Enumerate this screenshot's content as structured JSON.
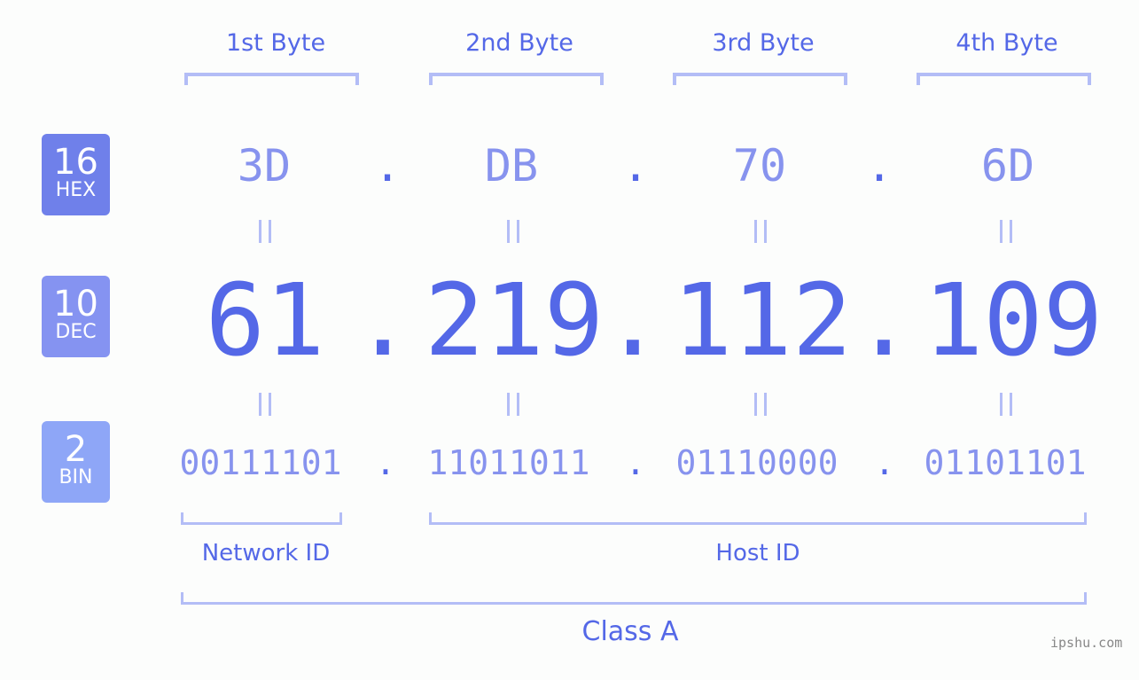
{
  "byte_headers": [
    "1st Byte",
    "2nd Byte",
    "3rd Byte",
    "4th Byte"
  ],
  "badges": {
    "hex": {
      "base": "16",
      "label": "HEX",
      "color": "#6f80ea"
    },
    "dec": {
      "base": "10",
      "label": "DEC",
      "color": "#8593f1"
    },
    "bin": {
      "base": "2",
      "label": "BIN",
      "color": "#8ea6f7"
    }
  },
  "hex_values": [
    "3D",
    "DB",
    "70",
    "6D"
  ],
  "dec_values": [
    "61",
    "219",
    "112",
    "109"
  ],
  "bin_values": [
    "00111101",
    "11011011",
    "01110000",
    "01101101"
  ],
  "separator": ".",
  "groups": {
    "network_id": "Network ID",
    "host_id": "Host ID",
    "class": "Class A"
  },
  "watermark": "ipshu.com",
  "colors": {
    "accent": "#5468e7",
    "light": "#8793ee",
    "bracket": "#b3bdf6"
  }
}
